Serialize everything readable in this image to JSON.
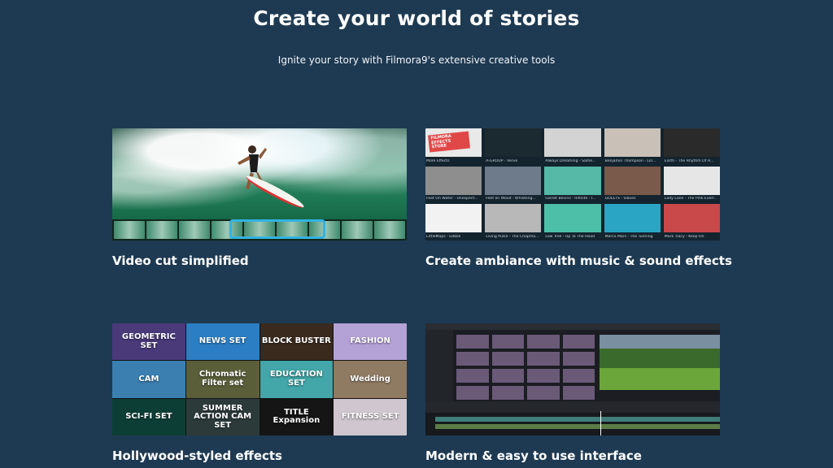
{
  "header": {
    "title": "Create your world of stories",
    "subtitle": "Ignite your story with Filmora9's extensive creative tools"
  },
  "features": [
    {
      "caption": "Video cut simplified"
    },
    {
      "caption": "Create ambiance with music & sound effects"
    },
    {
      "caption": "Hollywood-styled effects"
    },
    {
      "caption": "Modern & easy to use interface"
    }
  ],
  "music_tiles": [
    {
      "label": "More Effects",
      "color": "#e9e9e9"
    },
    {
      "label": "A-GROUP - Verve",
      "color": "#1b2a30"
    },
    {
      "label": "Always Dreaming - Same...",
      "color": "#d3d3d3"
    },
    {
      "label": "Benjamin Thompson - Lol...",
      "color": "#c9c0b8"
    },
    {
      "label": "Earth - The Rhythm Of H...",
      "color": "#2a2a2a"
    },
    {
      "label": "Feet On Water - Unexpect...",
      "color": "#8e8e8e"
    },
    {
      "label": "Feet on Wood - Whistling...",
      "color": "#6d7b8a"
    },
    {
      "label": "Garret Bevins - Infinite - I...",
      "color": "#56b8a6"
    },
    {
      "label": "GOLETS - Slaves",
      "color": "#7a5a4a"
    },
    {
      "label": "Lady Lane - The Pink Everl...",
      "color": "#e6e6e6"
    },
    {
      "label": "LittleMaps - Edible",
      "color": "#f2f2f2"
    },
    {
      "label": "Living Pulse - The Chapma...",
      "color": "#b8b8b8"
    },
    {
      "label": "Low Tree - Up To The Hood",
      "color": "#4dbfa8"
    },
    {
      "label": "Marco Mars - The Tunning",
      "color": "#2aa6c4"
    },
    {
      "label": "Mark Tracy - Keep On",
      "color": "#c9484a"
    }
  ],
  "music_store_badge": "FILMORA EFFECTS STORE",
  "effects_tiles": [
    {
      "text": "GEOMETRIC SET",
      "color": "#4a3a7a"
    },
    {
      "text": "NEWS SET",
      "color": "#2b7ec4"
    },
    {
      "text": "BLOCK BUSTER",
      "color": "#3a2a1e"
    },
    {
      "text": "FASHION",
      "color": "#b4a2d6"
    },
    {
      "text": "CAM",
      "color": "#3a7fb0"
    },
    {
      "text": "Chromatic Filter set",
      "color": "#5a5f3a"
    },
    {
      "text": "EDUCATION SET",
      "color": "#43a6a8"
    },
    {
      "text": "Wedding",
      "color": "#8f7a62"
    },
    {
      "text": "SCI-FI SET",
      "color": "#0d3e36"
    },
    {
      "text": "SUMMER ACTION CAM SET",
      "color": "#2c3a3a"
    },
    {
      "text": "TITLE Expansion",
      "color": "#151515"
    },
    {
      "text": "FITNESS SET",
      "color": "#cfc6cf"
    }
  ],
  "colors": {
    "background": "#1e3a52",
    "accent": "#33b3e0"
  }
}
